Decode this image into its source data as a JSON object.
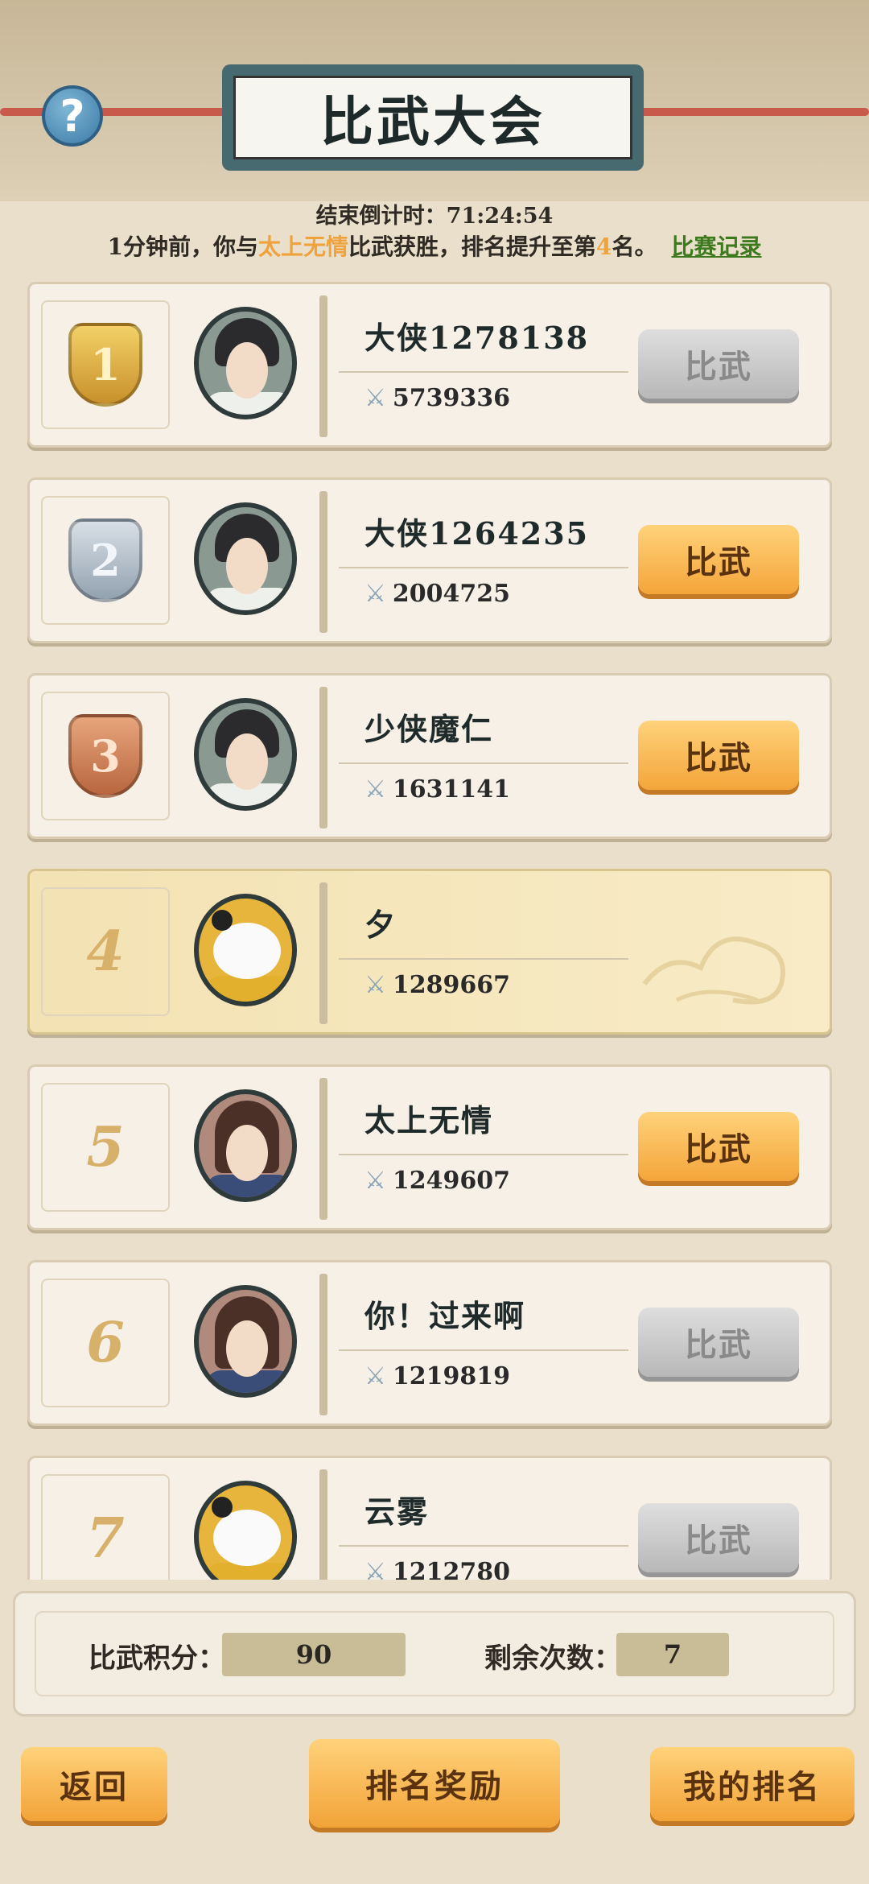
{
  "header": {
    "title": "比武大会",
    "help_icon": "?",
    "countdown_label": "结束倒计时：",
    "countdown_value": "71:24:54",
    "notice_prefix": "1分钟前，你与",
    "notice_opponent": "太上无情",
    "notice_middle": "比武获胜，排名提升至第",
    "notice_rank": "4",
    "notice_suffix": "名。",
    "record_link": "比赛记录"
  },
  "players": [
    {
      "rank": "1",
      "rank_style": "gold",
      "name": "大侠1278138",
      "power": "5739336",
      "avatar": "swordsman",
      "button": "比武",
      "button_state": "disabled"
    },
    {
      "rank": "2",
      "rank_style": "silver",
      "name": "大侠1264235",
      "power": "2004725",
      "avatar": "swordsman",
      "button": "比武",
      "button_state": "active"
    },
    {
      "rank": "3",
      "rank_style": "bronze",
      "name": "少侠魔仁",
      "power": "1631141",
      "avatar": "swordsman",
      "button": "比武",
      "button_state": "active"
    },
    {
      "rank": "4",
      "rank_style": "plain",
      "name": "夕",
      "power": "1289667",
      "avatar": "panda",
      "button": "",
      "button_state": "self"
    },
    {
      "rank": "5",
      "rank_style": "plain",
      "name": "太上无情",
      "power": "1249607",
      "avatar": "woman",
      "button": "比武",
      "button_state": "active"
    },
    {
      "rank": "6",
      "rank_style": "plain",
      "name": "你！过来啊",
      "power": "1219819",
      "avatar": "woman",
      "button": "比武",
      "button_state": "disabled"
    },
    {
      "rank": "7",
      "rank_style": "plain",
      "name": "云雾",
      "power": "1212780",
      "avatar": "panda",
      "button": "比武",
      "button_state": "disabled"
    }
  ],
  "stats": {
    "score_label": "比武积分：",
    "score_value": "90",
    "remaining_label": "剩余次数：",
    "remaining_value": "7"
  },
  "footer": {
    "back": "返回",
    "rewards": "排名奖励",
    "my_rank": "我的排名"
  },
  "colors": {
    "accent_orange": "#f4a53a",
    "highlight_text": "#f0a23c",
    "link_green": "#3d7a1e"
  }
}
